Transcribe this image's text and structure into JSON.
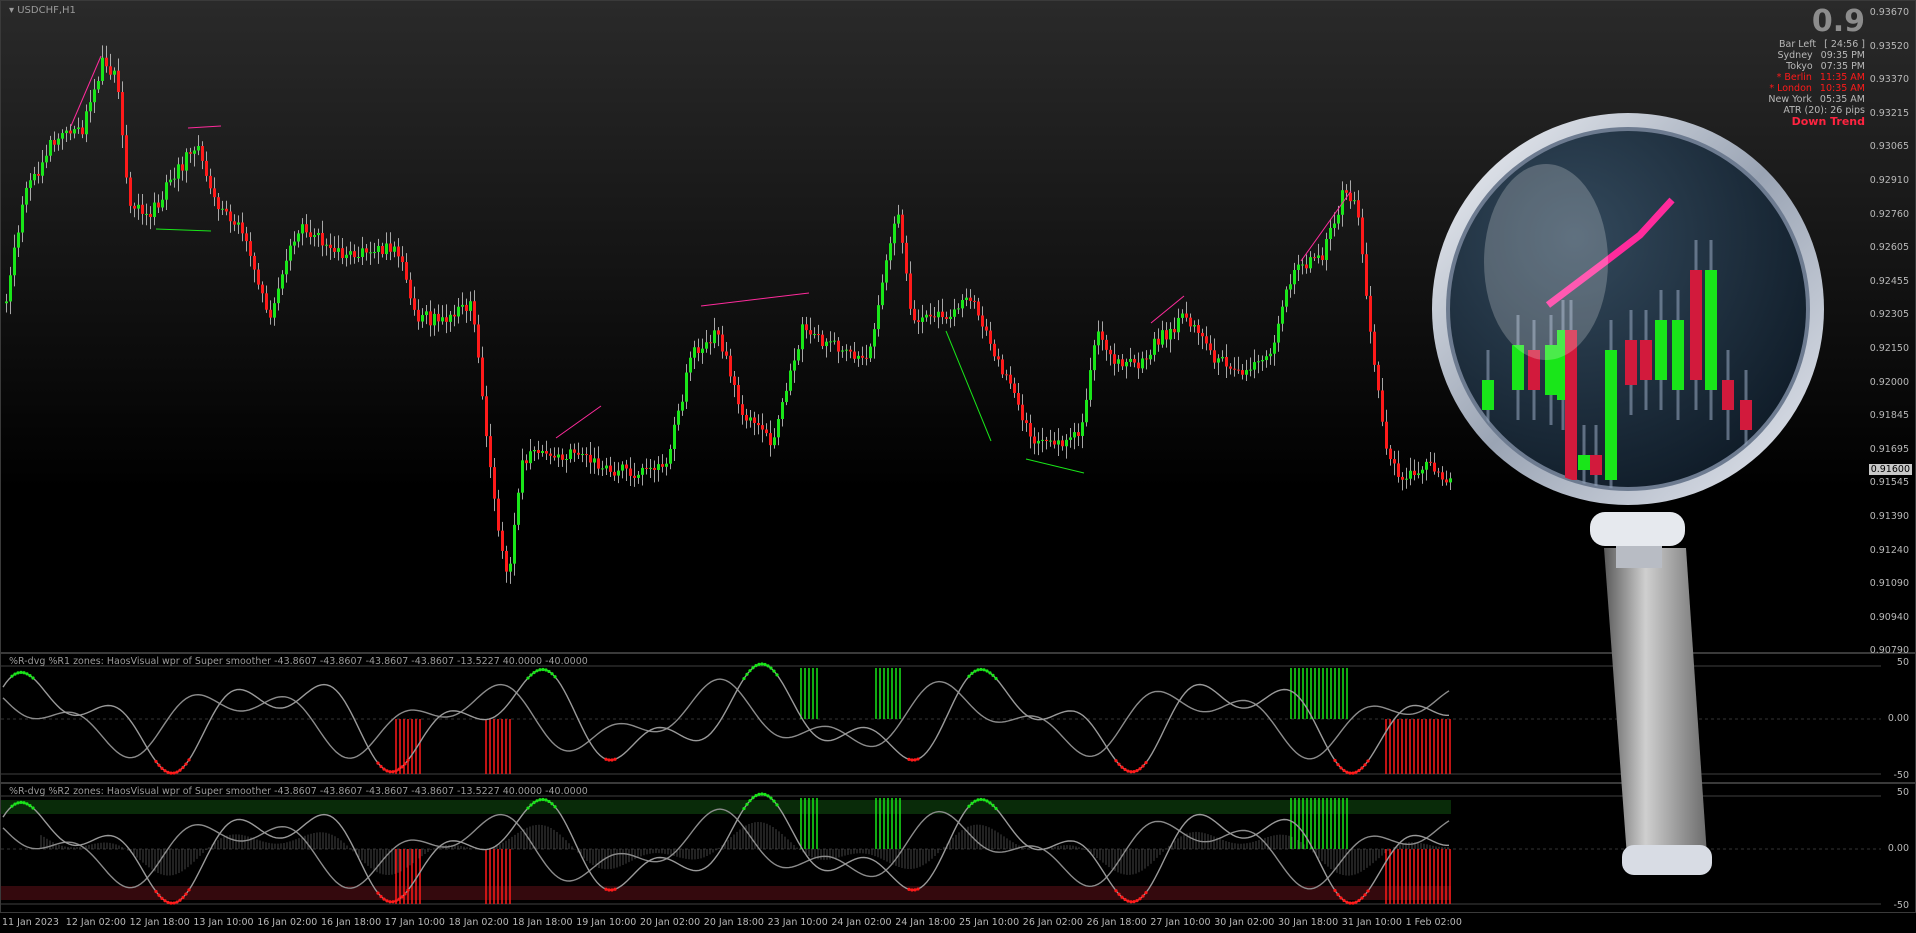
{
  "symbol": "USDCHF,H1",
  "colors": {
    "bull": "#19e619",
    "bear": "#ff1a1a",
    "pink": "#ff2b9c",
    "gray": "#8c8c8c",
    "accent_red": "#ff2440"
  },
  "info_panel": {
    "big_value": "0.9",
    "rows": [
      {
        "label": "Bar Left",
        "value": "[ 24:56 ]",
        "color": "#b8b8b8"
      },
      {
        "label": "Sydney",
        "value": "09:35 PM",
        "color": "#b8b8b8"
      },
      {
        "label": "Tokyo",
        "value": "07:35 PM",
        "color": "#b8b8b8"
      },
      {
        "label": "* Berlin",
        "value": "11:35 AM",
        "color": "#ff1a1a"
      },
      {
        "label": "* London",
        "value": "10:35 AM",
        "color": "#ff1a1a"
      },
      {
        "label": "New York",
        "value": "05:35 AM",
        "color": "#b8b8b8"
      },
      {
        "label": "ATR (20): 26 pips",
        "value": "",
        "color": "#b8b8b8"
      }
    ],
    "trend": "Down Trend"
  },
  "price_axis": [
    "0.93670",
    "0.93520",
    "0.93370",
    "0.93215",
    "0.93065",
    "0.92910",
    "0.92760",
    "0.92605",
    "0.92455",
    "0.92305",
    "0.92150",
    "0.92000",
    "0.91845",
    "0.91695",
    "0.91545",
    "0.91390",
    "0.91240",
    "0.91090",
    "0.90940",
    "0.90790"
  ],
  "current_price": "0.91600",
  "indicator1": {
    "title": "%R-dvg %R1 zones:  HaosVisual wpr of Super smoother -43.8607 -43.8607 -43.8607 -43.8607 -13.5227 40.0000 -40.0000",
    "levels": [
      "50",
      "0.00",
      "-50"
    ]
  },
  "indicator2": {
    "title": "%R-dvg %R2 zones:  HaosVisual wpr of Super smoother -43.8607 -43.8607 -43.8607 -43.8607 -13.5227 40.0000 -40.0000",
    "levels": [
      "50",
      "0.00",
      "-50"
    ]
  },
  "time_axis": [
    "11 Jan 2023",
    "12 Jan 02:00",
    "12 Jan 18:00",
    "13 Jan 10:00",
    "16 Jan 02:00",
    "16 Jan 18:00",
    "17 Jan 10:00",
    "18 Jan 02:00",
    "18 Jan 18:00",
    "19 Jan 10:00",
    "20 Jan 02:00",
    "20 Jan 18:00",
    "23 Jan 10:00",
    "24 Jan 02:00",
    "24 Jan 18:00",
    "25 Jan 10:00",
    "26 Jan 02:00",
    "26 Jan 18:00",
    "27 Jan 10:00",
    "30 Jan 02:00",
    "30 Jan 18:00",
    "31 Jan 10:00",
    "1 Feb 02:00"
  ]
}
